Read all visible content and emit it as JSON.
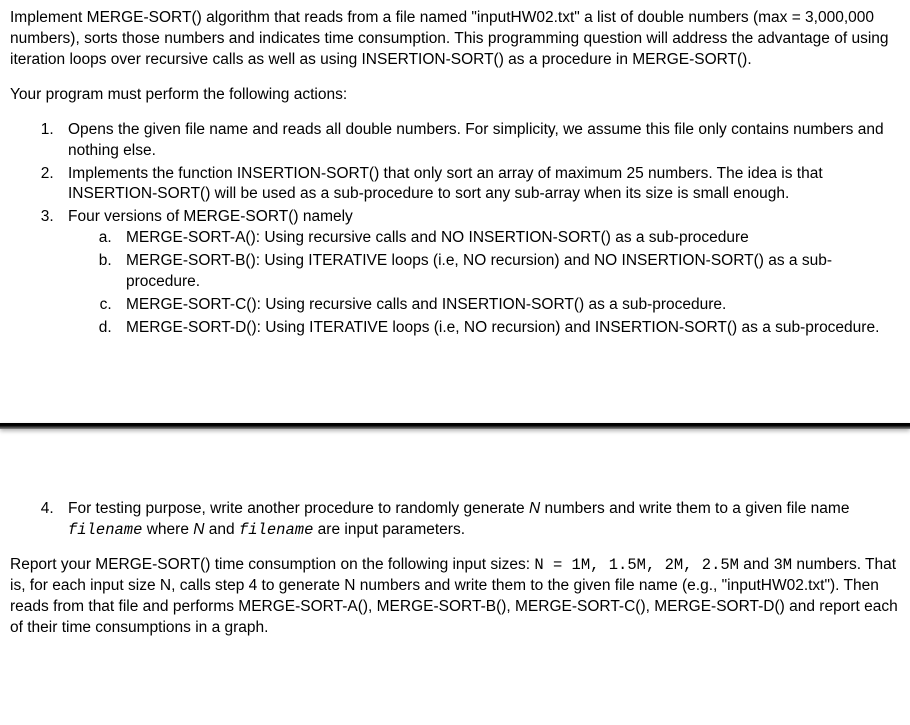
{
  "intro": {
    "p1_a": "Implement MERGE-SORT() algorithm that reads from a file named \"inputHW02.txt\" a list of double numbers (max = 3,000,000 numbers), sorts those numbers and indicates time consumption. This programming question will address the advantage of using iteration loops over recursive calls as well as using INSERTION-SORT() as a procedure in MERGE-SORT().",
    "p2": "Your program must perform the following actions:"
  },
  "steps": {
    "s1": "Opens the given file name and reads all double numbers. For simplicity, we assume this file only contains numbers and nothing else.",
    "s2": "Implements the function INSERTION-SORT() that only sort an array of maximum 25 numbers. The idea is that INSERTION-SORT() will be used as a sub-procedure to sort any sub-array when its size is small enough.",
    "s3": "Four versions of MERGE-SORT() namely",
    "s3a": "MERGE-SORT-A(): Using recursive calls and NO INSERTION-SORT() as a sub-procedure",
    "s3b": "MERGE-SORT-B(): Using ITERATIVE loops (i.e, NO recursion) and NO INSERTION-SORT() as a sub-procedure.",
    "s3c": "MERGE-SORT-C(): Using recursive calls and INSERTION-SORT() as a sub-procedure.",
    "s3d": "MERGE-SORT-D(): Using ITERATIVE loops (i.e, NO recursion) and INSERTION-SORT() as a sub-procedure.",
    "s4_a": "For testing purpose, write another procedure to randomly generate ",
    "s4_n": "N",
    "s4_b": " numbers and write them to a given file name ",
    "s4_fn1": "filename",
    "s4_c": " where ",
    "s4_n2": "N",
    "s4_d": " and ",
    "s4_fn2": "filename",
    "s4_e": " are input parameters."
  },
  "footer": {
    "a": "Report your MERGE-SORT() time consumption on the following input sizes: ",
    "sizes_label": "N = 1M, 1.5M, 2M, 2.5M",
    "b": " and ",
    "last_size": "3M",
    "c": " numbers. That is, for each input size N, calls step 4 to generate N numbers and write them to the given file name (e.g., \"inputHW02.txt\"). Then reads from that file and performs MERGE-SORT-A(), MERGE-SORT-B(), MERGE-SORT-C(), MERGE-SORT-D() and report each of their time consumptions in a graph."
  }
}
